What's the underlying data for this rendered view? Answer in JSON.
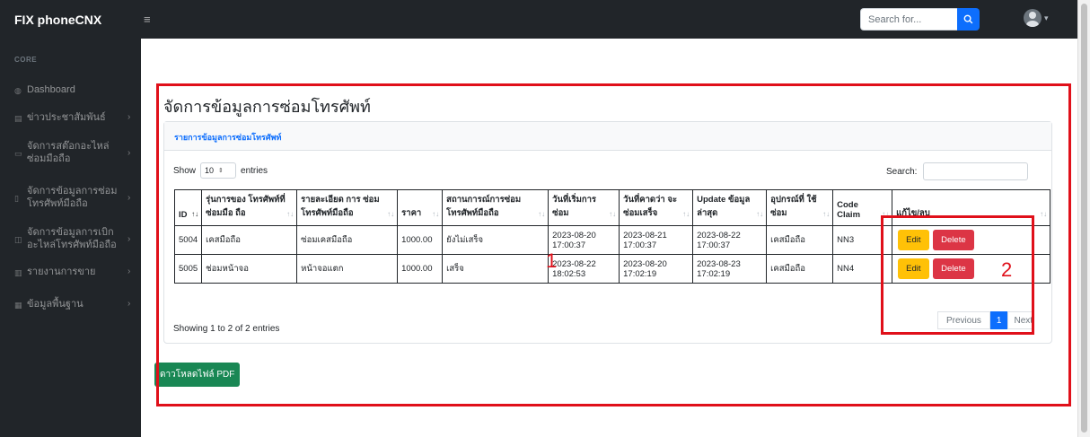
{
  "navbar": {
    "brand": "FIX phoneCNX",
    "search_placeholder": "Search for...",
    "caret": "▾"
  },
  "sidebar": {
    "heading": "CORE",
    "items": [
      {
        "label": "Dashboard",
        "icon": "dashboard-icon"
      },
      {
        "label": "ข่าวประชาสัมพันธ์",
        "icon": "news-icon"
      },
      {
        "label": "จัดการสต๊อกอะไหล่ซ่อมมือถือ",
        "icon": "stock-icon"
      },
      {
        "label": "จัดการข้อมูลการซ่อมโทรศัพท์มือถือ",
        "icon": "repair-icon"
      },
      {
        "label": "จัดการข้อมูลการเบิกอะไหล่โทรศัพท์มือถือ",
        "icon": "withdraw-icon"
      },
      {
        "label": "รายงานการขาย",
        "icon": "report-icon"
      },
      {
        "label": "ข้อมูลพื้นฐาน",
        "icon": "database-icon"
      }
    ]
  },
  "page": {
    "title": "จัดการข้อมูลการซ่อมโทรศัพท์",
    "card_header": "รายการข้อมูลการซ่อมโทรศัพท์",
    "show_label": "Show",
    "entries_value": "10",
    "entries_label": "entries",
    "search_label": "Search:",
    "info": "Showing 1 to 2 of 2 entries",
    "pager": {
      "previous": "Previous",
      "current": "1",
      "next": "Next"
    },
    "pdf_button": "ดาวโหลดไฟล์ PDF"
  },
  "table": {
    "headers": [
      "ID",
      "รุ่นการของ โทรศัพท์ที่ซ่อมมือ ถือ",
      "รายละเอียด การ ซ่อมโทรศัพท์มือถือ",
      "ราคา",
      "สถานการณ์การซ่อม โทรศัพท์มือถือ",
      "วันที่เริ่มการ ซ่อม",
      "วันที่คาดว่า จะซ่อมเสร็จ",
      "Update ข้อมูลล่าสุด",
      "อุปกรณ์ที่ ใช้ซ่อม",
      "Code Claim",
      "แก้ไข/ลบ"
    ],
    "rows": [
      [
        "5004",
        "เคสมือถือ",
        "ซ่อมเคสมือถือ",
        "1000.00",
        "ยังไม่เสร็จ",
        "2023-08-20 17:00:37",
        "2023-08-21 17:00:37",
        "2023-08-22 17:00:37",
        "เคสมือถือ",
        "NN3"
      ],
      [
        "5005",
        "ช่อมหน้าจอ",
        "หน้าจอแตก",
        "1000.00",
        "เสร็จ",
        "2023-08-22 18:02:53",
        "2023-08-20 17:02:19",
        "2023-08-23 17:02:19",
        "เคสมือถือ",
        "NN4"
      ]
    ],
    "edit_label": "Edit",
    "delete_label": "Delete"
  },
  "annotations": {
    "label_1": "1",
    "label_2": "2",
    "color": "#e0101a"
  },
  "colors": {
    "nav_bg": "#212529",
    "primary": "#0d6efd",
    "warning": "#ffc107",
    "danger": "#dc3545",
    "success": "#198754"
  }
}
